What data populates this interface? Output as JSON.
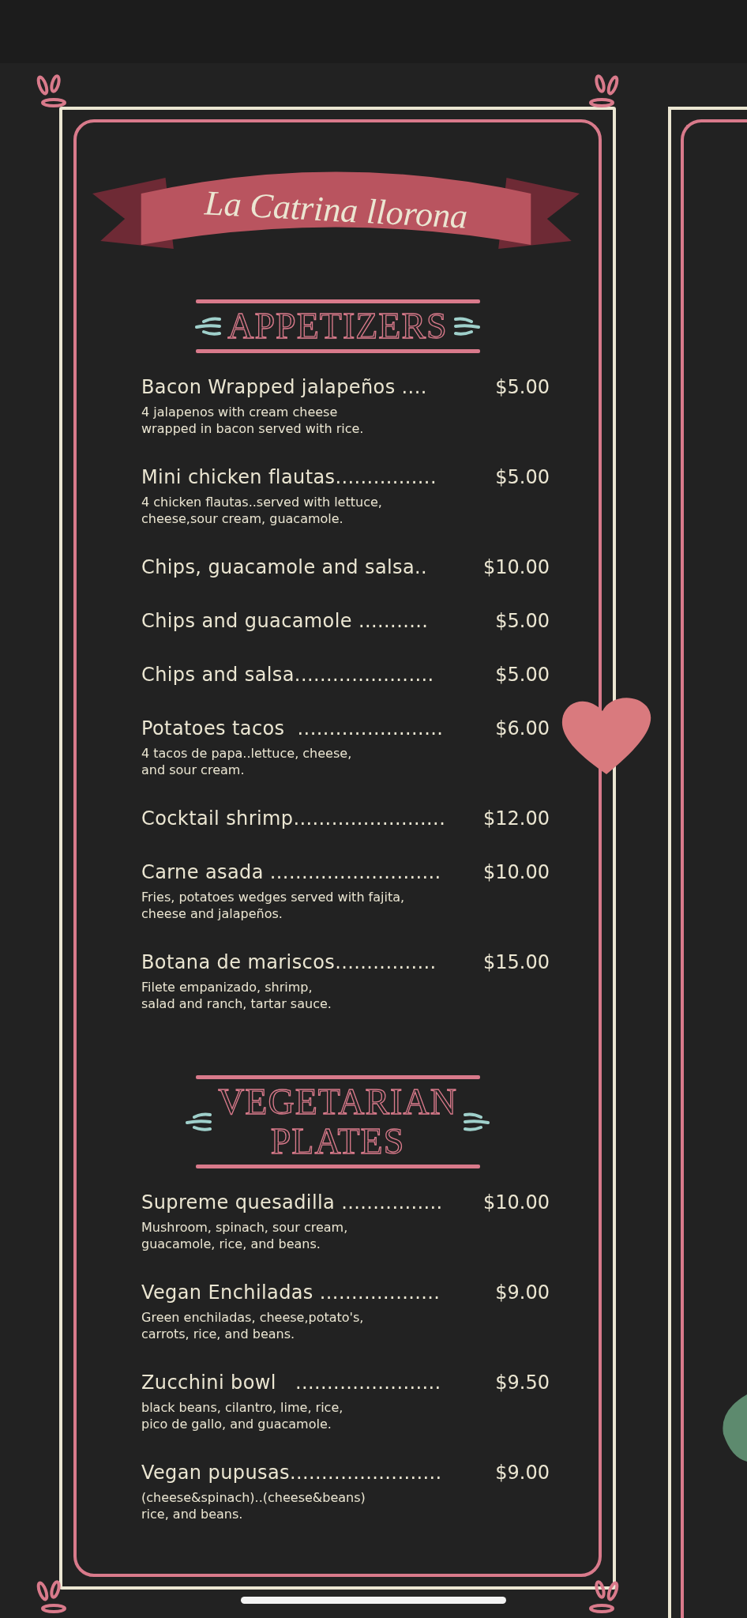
{
  "title": "La Catrina llorona",
  "sections": [
    {
      "heading": [
        "APPETIZERS"
      ],
      "items": [
        {
          "name": "Bacon Wrapped jalapeños ....",
          "price": "$5.00",
          "description": "4 jalapenos with cream cheese\nwrapped in bacon served with rice."
        },
        {
          "name": "Mini chicken flautas................",
          "price": "$5.00",
          "description": "4 chicken flautas..served with lettuce,\ncheese,sour cream, guacamole."
        },
        {
          "name": "Chips, guacamole and salsa..",
          "price": "$10.00"
        },
        {
          "name": "Chips and guacamole ...........",
          "price": "$5.00"
        },
        {
          "name": "Chips and salsa......................",
          "price": "$5.00"
        },
        {
          "name": "Potatoes tacos  .......................",
          "price": "$6.00",
          "description": "4 tacos de papa..lettuce, cheese,\nand sour cream."
        },
        {
          "name": "Cocktail shrimp........................",
          "price": "$12.00"
        },
        {
          "name": "Carne asada ...........................",
          "price": "$10.00",
          "description": "Fries, potatoes wedges served with fajita,\ncheese and jalapeños."
        },
        {
          "name": "Botana de mariscos................",
          "price": "$15.00",
          "description": "Filete empanizado, shrimp,\nsalad and ranch, tartar sauce."
        }
      ]
    },
    {
      "heading": [
        "VEGETARIAN",
        "PLATES"
      ],
      "items": [
        {
          "name": "Supreme quesadilla ................",
          "price": "$10.00",
          "description": "Mushroom, spinach, sour cream,\nguacamole, rice, and beans."
        },
        {
          "name": "Vegan Enchiladas ...................",
          "price": "$9.00",
          "description": "Green enchiladas, cheese,potato's,\ncarrots, rice, and beans."
        },
        {
          "name": "Zucchini bowl   .......................",
          "price": "$9.50",
          "description": "black beans, cilantro, lime, rice,\npico de gallo, and guacamole."
        },
        {
          "name": "Vegan pupusas........................",
          "price": "$9.00",
          "description": "(cheese&spinach)..(cheese&beans)\nrice, and beans."
        }
      ]
    }
  ]
}
